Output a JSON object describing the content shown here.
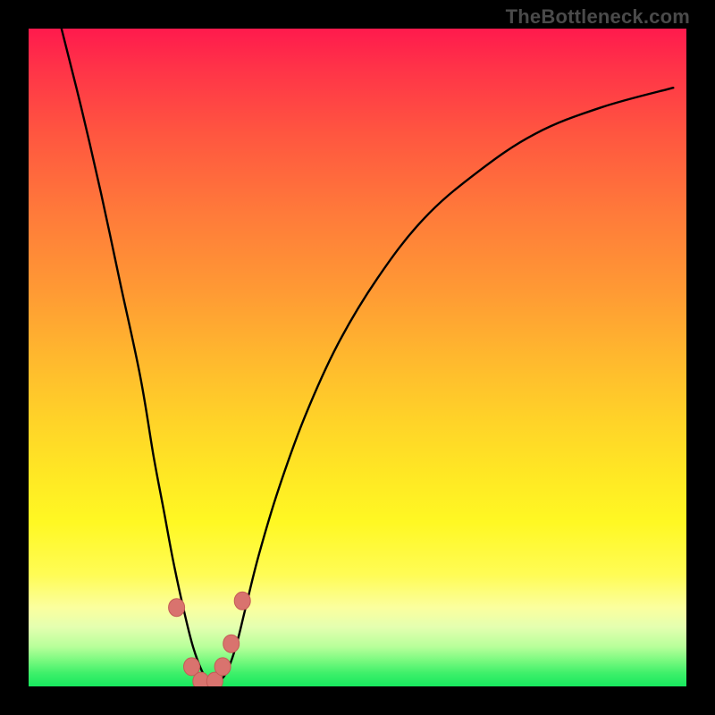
{
  "watermark": "TheBottleneck.com",
  "colors": {
    "frame": "#000000",
    "curve_stroke": "#000000",
    "marker_fill": "#d9736e",
    "marker_stroke": "#c45b56",
    "gradient_top": "#ff1a4d",
    "gradient_bottom": "#17e85e"
  },
  "chart_data": {
    "type": "line",
    "title": "",
    "xlabel": "",
    "ylabel": "",
    "xlim": [
      0,
      100
    ],
    "ylim": [
      0,
      100
    ],
    "grid": false,
    "legend": false,
    "annotations": [
      "TheBottleneck.com"
    ],
    "series": [
      {
        "name": "bottleneck-curve",
        "x": [
          5,
          8,
          11,
          14,
          17,
          19,
          20.5,
          22,
          23.5,
          25,
          26.5,
          27.5,
          28.5,
          30,
          31.5,
          33,
          35,
          38,
          42,
          47,
          53,
          60,
          68,
          77,
          87,
          98
        ],
        "y": [
          100,
          88,
          75,
          61,
          47,
          35,
          27,
          19,
          12,
          6,
          2,
          0.5,
          0.5,
          2,
          6,
          12,
          20,
          30,
          41,
          52,
          62,
          71,
          78,
          84,
          88,
          91
        ]
      }
    ],
    "markers": [
      {
        "x": 22.5,
        "y": 12
      },
      {
        "x": 24.8,
        "y": 3
      },
      {
        "x": 26.2,
        "y": 0.8
      },
      {
        "x": 28.3,
        "y": 0.8
      },
      {
        "x": 29.5,
        "y": 3
      },
      {
        "x": 30.8,
        "y": 6.5
      },
      {
        "x": 32.5,
        "y": 13
      }
    ]
  }
}
